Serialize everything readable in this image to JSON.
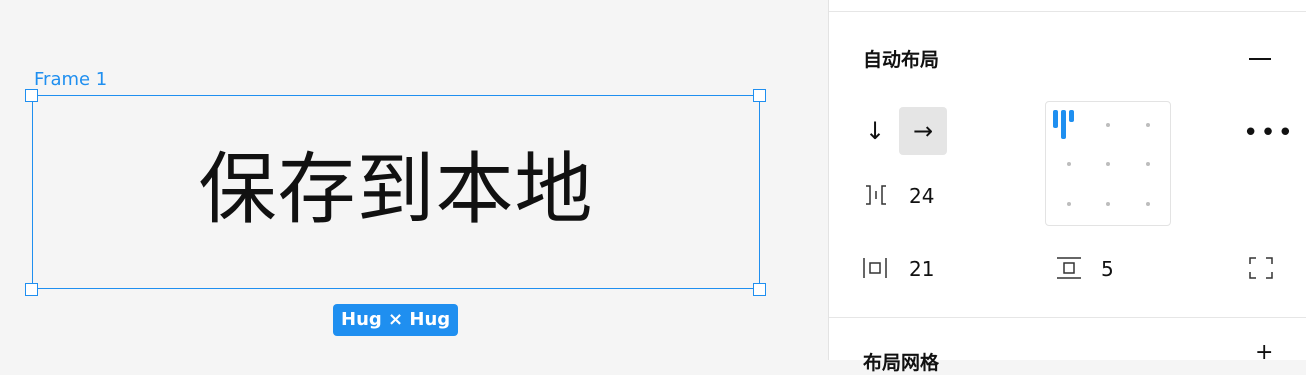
{
  "canvas": {
    "frame_label": "Frame 1",
    "frame_text": "保存到本地",
    "size_badge": "Hug × Hug",
    "accent_color": "#1f8ff0"
  },
  "panel": {
    "section_title": "自动布局",
    "direction": {
      "vertical_icon": "arrow-down-icon",
      "horizontal_icon": "arrow-right-icon",
      "selected": "horizontal"
    },
    "gap": {
      "icon": "spacing-between-icon",
      "value": "24"
    },
    "horizontal_padding": {
      "icon": "horizontal-padding-icon",
      "value": "21"
    },
    "vertical_padding": {
      "icon": "vertical-padding-icon",
      "value": "5"
    },
    "alignment": "top-left",
    "next_section_title": "布局网格"
  }
}
